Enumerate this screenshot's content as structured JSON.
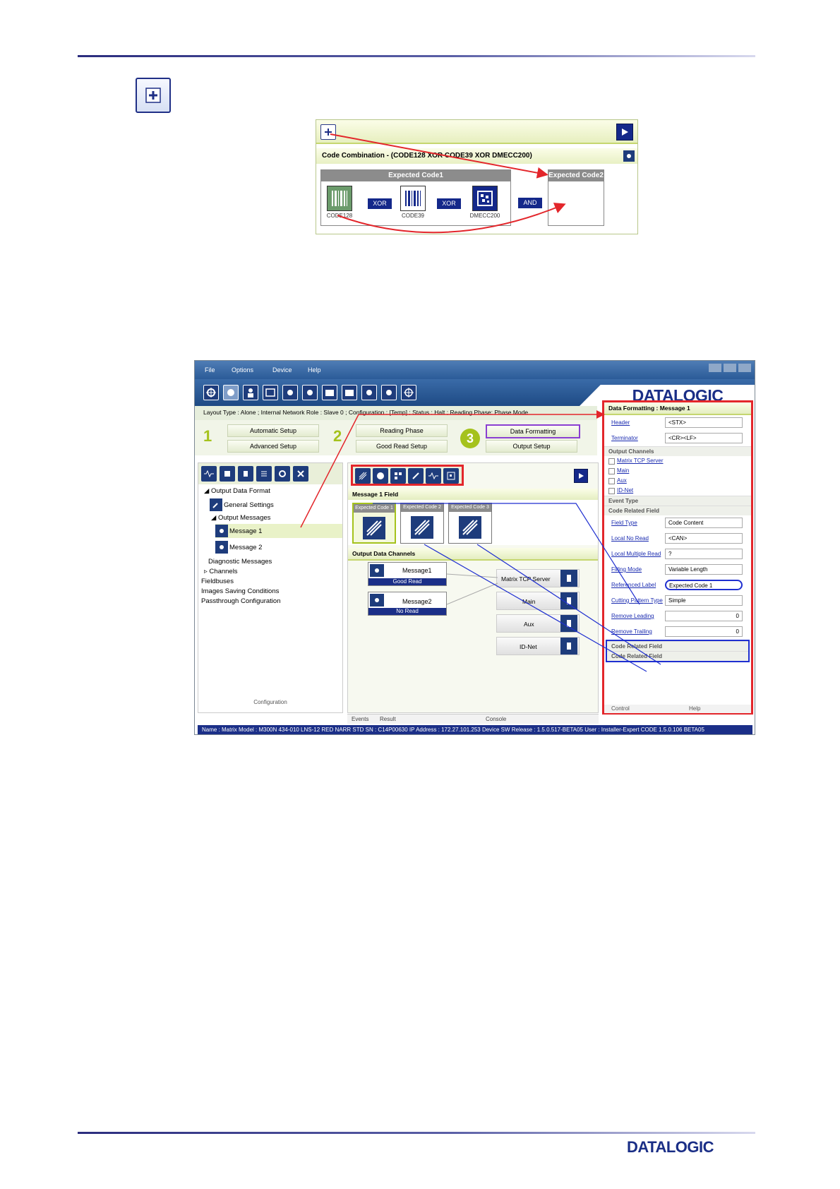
{
  "header_rule": true,
  "code_combination": {
    "title": "Code Combination  -  (CODE128 XOR CODE39 XOR DMECC200)",
    "expected_code1": "Expected Code1",
    "expected_code2": "Expected Code2",
    "op1": "XOR",
    "op2": "XOR",
    "op3": "AND",
    "code1": "CODE128",
    "code2": "CODE39",
    "code3": "DMECC200"
  },
  "window": {
    "menu": [
      "File",
      "Options",
      "Device",
      "Help"
    ],
    "logo": "DATALOGIC",
    "status_line": "Layout Type :  Alone ;  Internal Network Role :  Slave 0 ;  Configuration :  [Temp] ;  Status :  Halt ;  Reading Phase:  Phase Mode",
    "steps": {
      "n1": "1",
      "n2": "2",
      "n3": "3",
      "automatic_setup": "Automatic Setup",
      "advanced_setup": "Advanced Setup",
      "reading_phase": "Reading Phase",
      "good_read_setup": "Good Read Setup",
      "data_formatting": "Data Formatting",
      "output_setup": "Output Setup"
    },
    "tree": {
      "output_data_format": "Output Data Format",
      "general_settings": "General Settings",
      "output_messages": "Output Messages",
      "message1": "Message 1",
      "message2": "Message 2",
      "diagnostic_messages": "Diagnostic Messages",
      "channels": "Channels",
      "fieldbuses": "Fieldbuses",
      "images_saving": "Images Saving Conditions",
      "passthrough": "Passthrough Configuration",
      "footer": "Configuration"
    },
    "mid": {
      "message1_field": "Message 1 Field",
      "ec1": "Expected Code  1",
      "ec2": "Expected Code  2",
      "ec3": "Expected Code  3",
      "output_data_channels": "Output Data Channels",
      "msg1": "Message1",
      "msg1_status": "Good Read",
      "msg2": "Message2",
      "msg2_status": "No Read",
      "chan1": "Matrix TCP Server",
      "chan2": "Main",
      "chan3": "Aux",
      "chan4": "ID-Net"
    },
    "tabs": {
      "events": "Events",
      "result": "Result",
      "console": "Console"
    },
    "right": {
      "title": "Data Formatting :  Message 1",
      "header_lab": "Header",
      "header_val": "<STX>",
      "terminator_lab": "Terminator",
      "terminator_val": "<CR><LF>",
      "output_channels": "Output Channels",
      "oc1": "Matrix TCP Server",
      "oc2": "Main",
      "oc3": "Aux",
      "oc4": "ID-Net",
      "event_type": "Event Type",
      "code_related_field": "Code Related Field",
      "field_type_lab": "Field Type",
      "field_type_val": "Code Content",
      "local_no_read_lab": "Local No Read",
      "local_no_read_val": "<CAN>",
      "local_multiple_read_lab": "Local Multiple Read",
      "local_multiple_read_val": "?",
      "filling_mode_lab": "Filling Mode",
      "filling_mode_val": "Variable Length",
      "referenced_label_lab": "Referenced Label",
      "referenced_label_val": "Expected Code   1",
      "cutting_pattern_lab": "Cutting Pattern Type",
      "cutting_pattern_val": "Simple",
      "remove_leading_lab": "Remove Leading",
      "remove_leading_val": "0",
      "remove_trailing_lab": "Remove Trailing",
      "remove_trailing_val": "0",
      "crf2": "Code Related Field",
      "crf3": "Code Related Field",
      "control": "Control",
      "help": "Help"
    },
    "statusbar": "Name : Matrix   Model : M300N 434-010 LNS-12 RED NARR STD   SN : C14P00630   IP Address :  172.27.101.253   Device SW Release : 1.5.0.517-BETA05   User : Installer-Expert   CODE 1.5.0.106 BETA05"
  },
  "footer_logo": "DATALOGIC"
}
